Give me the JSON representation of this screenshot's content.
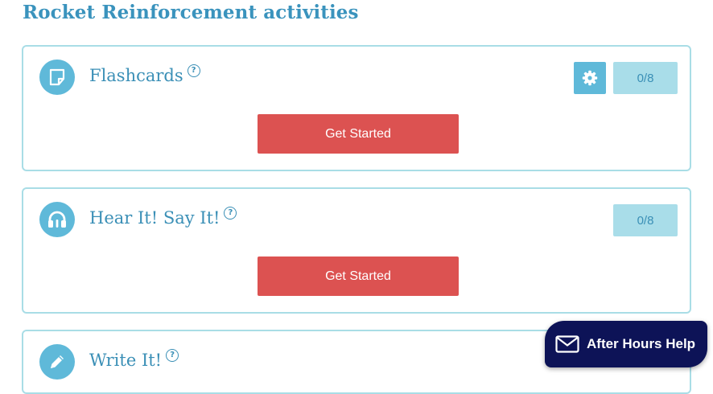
{
  "page": {
    "title": "Rocket Reinforcement activities"
  },
  "activities": [
    {
      "title": "Flashcards",
      "progress": "0/8",
      "button_label": "Get Started",
      "has_settings": true,
      "icon": "sticky-note-icon"
    },
    {
      "title": "Hear It! Say It!",
      "progress": "0/8",
      "button_label": "Get Started",
      "has_settings": false,
      "icon": "headphones-icon"
    },
    {
      "title": "Write It!",
      "icon": "pencil-icon"
    }
  ],
  "help_icon": "?",
  "help_widget": {
    "label": "After Hours Help",
    "icon": "envelope-icon"
  },
  "colors": {
    "accent": "#3a93bd",
    "icon_bg": "#5fb9d9",
    "badge_bg": "#a9dde9",
    "card_border": "#a9dde6",
    "button": "#dc5251",
    "widget_bg": "#0d1357"
  }
}
